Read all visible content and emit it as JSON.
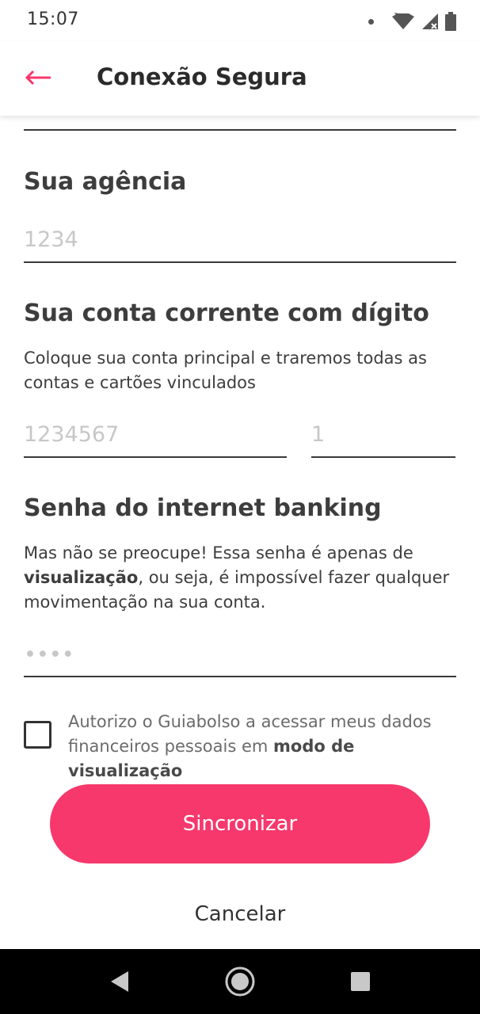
{
  "status_bar": {
    "time": "15:07"
  },
  "app_bar": {
    "title": "Conexão Segura",
    "back_icon": "arrow-left-icon",
    "accent_color": "#f7386c"
  },
  "form": {
    "agency": {
      "label": "Sua agência",
      "placeholder": "1234",
      "value": ""
    },
    "account": {
      "label": "Sua conta corrente com dígito",
      "description": "Coloque sua conta principal e traremos todas as contas e cartões vinculados",
      "number_placeholder": "1234567",
      "digit_placeholder": "1",
      "number_value": "",
      "digit_value": ""
    },
    "password": {
      "label": "Senha do internet banking",
      "description_part1": "Mas não se preocupe! Essa senha é apenas de ",
      "description_bold": "visualização",
      "description_part2": ", ou seja, é impossível fazer qualquer movimentação na sua conta.",
      "placeholder": "••••",
      "value": ""
    },
    "consent": {
      "text": "Autorizo o Guiabolso a acessar meus dados financeiros pessoais em ",
      "bold": "modo de visualização",
      "checked": false
    }
  },
  "actions": {
    "sync_label": "Sincronizar",
    "cancel_label": "Cancelar",
    "sync_color": "#f7386c"
  },
  "nav_bar": {
    "back_icon": "triangle-back-icon",
    "home_icon": "circle-home-icon",
    "recents_icon": "square-recents-icon"
  }
}
